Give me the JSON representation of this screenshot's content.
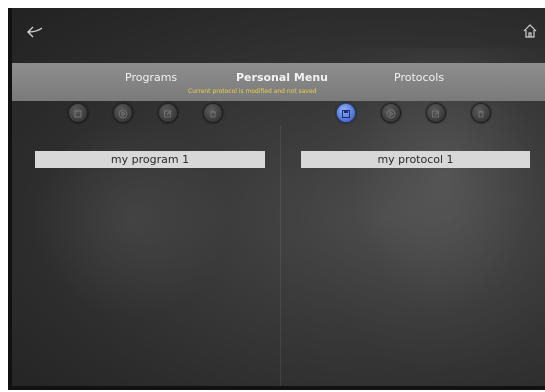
{
  "header": {
    "back_icon": "back-arrow-icon",
    "home_icon": "home-icon"
  },
  "tabs": {
    "programs": "Programs",
    "personal_menu": "Personal Menu",
    "protocols": "Protocols",
    "notice": "Current protocol is modified and not saved"
  },
  "toolbar_left": [
    "stop-icon",
    "play-icon",
    "edit-icon",
    "delete-icon"
  ],
  "toolbar_right": [
    "save-icon",
    "play-icon",
    "edit-icon",
    "delete-icon"
  ],
  "lists": {
    "programs": [
      "my program 1"
    ],
    "protocols": [
      "my protocol 1"
    ]
  },
  "colors": {
    "accent": "#4d73d6",
    "notice": "#e9d24a",
    "tabbar": "#858585"
  }
}
